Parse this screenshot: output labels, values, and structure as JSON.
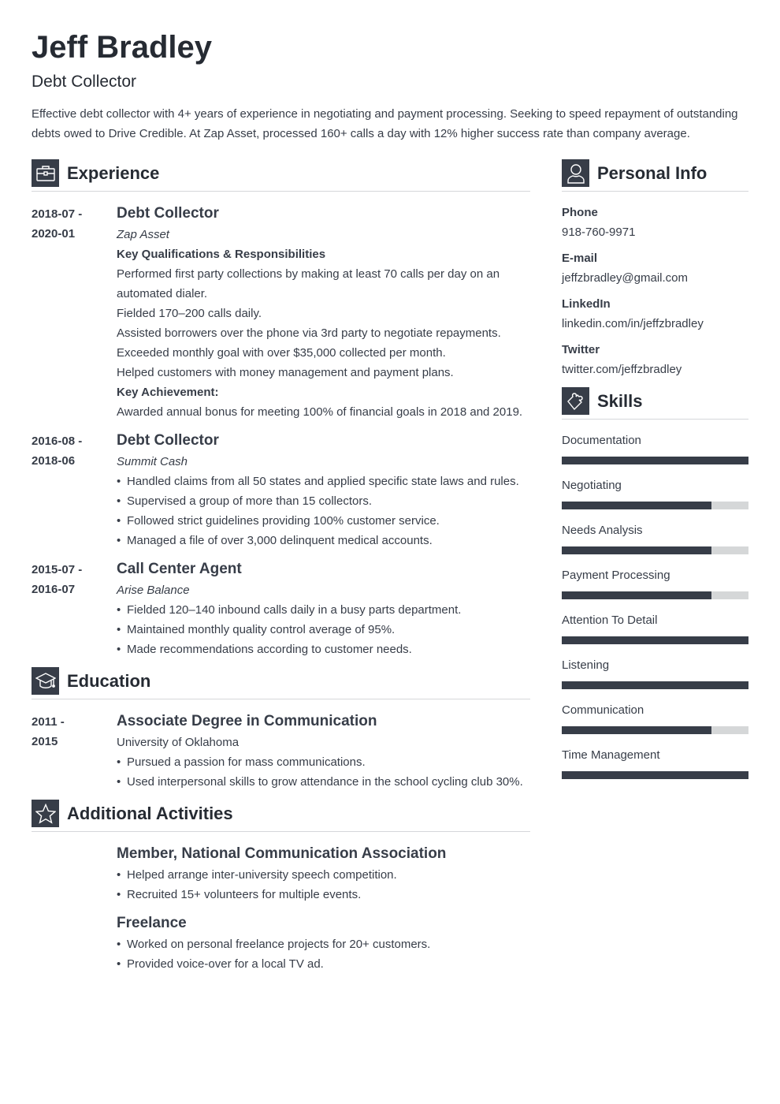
{
  "header": {
    "name": "Jeff Bradley",
    "title": "Debt Collector",
    "summary": "Effective debt collector with 4+ years of experience in negotiating and payment processing. Seeking to speed repayment of outstanding debts owed to Drive Credible. At Zap Asset, processed 160+ calls a day with 12% higher success rate than company average."
  },
  "experience": {
    "title": "Experience",
    "icon": "briefcase-icon",
    "entries": [
      {
        "date_start": "2018-07 -",
        "date_end": "2020-01",
        "role": "Debt Collector",
        "org": "Zap Asset",
        "qual_heading": "Key Qualifications & Responsibilities",
        "lines": [
          "Performed first party collections by making at least 70 calls per day on an automated dialer.",
          "Fielded 170–200 calls daily.",
          "Assisted borrowers over the phone via 3rd party to negotiate repayments.",
          "Exceeded monthly goal with over $35,000 collected per month.",
          "Helped customers with money management and payment plans."
        ],
        "achievement_heading": "Key Achievement:",
        "achievement": "Awarded annual bonus for meeting 100% of financial goals in 2018 and 2019."
      },
      {
        "date_start": "2016-08 -",
        "date_end": "2018-06",
        "role": "Debt Collector",
        "org": "Summit Cash",
        "bullets": [
          "Handled claims from all 50 states and applied specific state laws and rules.",
          "Supervised a group of more than 15 collectors.",
          "Followed strict guidelines providing 100% customer service.",
          "Managed a file of over 3,000 delinquent medical accounts."
        ]
      },
      {
        "date_start": "2015-07 -",
        "date_end": "2016-07",
        "role": "Call Center Agent",
        "org": "Arise Balance",
        "bullets": [
          "Fielded 120–140 inbound calls daily in a busy parts department.",
          "Maintained monthly quality control average of 95%.",
          "Made recommendations according to customer needs."
        ]
      }
    ]
  },
  "education": {
    "title": "Education",
    "icon": "graduation-cap-icon",
    "entries": [
      {
        "date_start": "2011 -",
        "date_end": "2015",
        "degree": "Associate Degree in Communication",
        "school": "University of Oklahoma",
        "bullets": [
          "Pursued a passion for mass communications.",
          "Used interpersonal skills to grow attendance in the school cycling club 30%."
        ]
      }
    ]
  },
  "activities": {
    "title": "Additional Activities",
    "icon": "star-icon",
    "entries": [
      {
        "title": "Member, National Communication Association",
        "bullets": [
          "Helped arrange inter-university speech competition.",
          "Recruited 15+ volunteers for multiple events."
        ]
      },
      {
        "title": "Freelance",
        "bullets": [
          "Worked on personal freelance projects for 20+ customers.",
          "Provided voice-over for a local TV ad."
        ]
      }
    ]
  },
  "personal_info": {
    "title": "Personal Info",
    "icon": "user-icon",
    "items": [
      {
        "label": "Phone",
        "value": "918-760-9971"
      },
      {
        "label": "E-mail",
        "value": "jeffzbradley@gmail.com"
      },
      {
        "label": "LinkedIn",
        "value": "linkedin.com/in/jeffzbradley"
      },
      {
        "label": "Twitter",
        "value": "twitter.com/jeffzbradley"
      }
    ]
  },
  "skills": {
    "title": "Skills",
    "icon": "puzzle-icon",
    "items": [
      {
        "name": "Documentation",
        "level": 1.0
      },
      {
        "name": "Negotiating",
        "level": 0.8
      },
      {
        "name": "Needs Analysis",
        "level": 0.8
      },
      {
        "name": "Payment Processing",
        "level": 0.8
      },
      {
        "name": "Attention To Detail",
        "level": 1.0
      },
      {
        "name": "Listening",
        "level": 1.0
      },
      {
        "name": "Communication",
        "level": 0.8
      },
      {
        "name": "Time Management",
        "level": 1.0
      }
    ]
  },
  "colors": {
    "accent": "#373d48",
    "bar_track": "#d5d7d8",
    "divider": "#d5d7da"
  }
}
